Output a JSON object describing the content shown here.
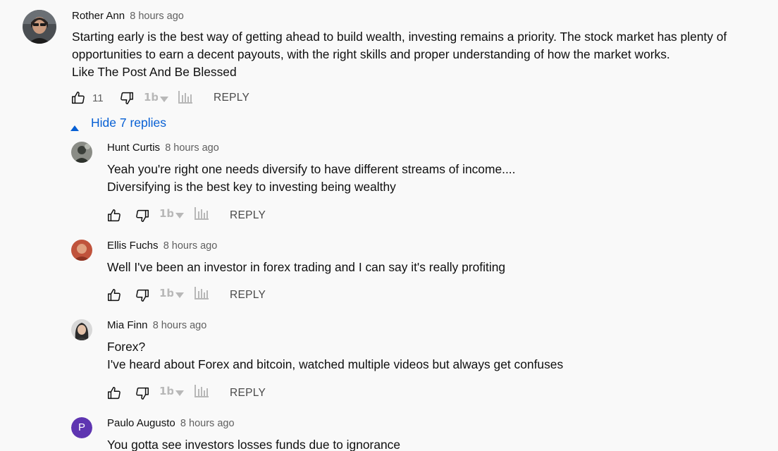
{
  "comment": {
    "author": "Rother Ann",
    "time": "8 hours ago",
    "text_lines": [
      "Starting early is the best way of getting ahead to build wealth, investing remains a priority. The stock market has plenty of",
      "opportunities to earn a decent payouts, with the right skills and proper understanding of how the market works.",
      "Like The Post And Be Blessed"
    ],
    "like_count": "11",
    "reply_label": "REPLY"
  },
  "toggle": {
    "label": "Hide 7 replies"
  },
  "replies": [
    {
      "author": "Hunt Curtis",
      "time": "8 hours ago",
      "text_lines": [
        "Yeah you're right one needs diversify to have different streams of income....",
        "Diversifying is the best key to investing being wealthy"
      ],
      "reply_label": "REPLY"
    },
    {
      "author": "Ellis Fuchs",
      "time": "8 hours ago",
      "text_lines": [
        "Well I've been an investor in forex trading and I can say it's really profiting"
      ],
      "reply_label": "REPLY"
    },
    {
      "author": "Mia Finn",
      "time": "8 hours ago",
      "text_lines": [
        "Forex?",
        "I've heard about Forex and bitcoin, watched multiple videos but always get confuses"
      ],
      "reply_label": "REPLY"
    },
    {
      "author": "Paulo Augusto",
      "avatar_letter": "P",
      "time": "8 hours ago",
      "text_lines": [
        "You gotta see investors losses funds due  to ignorance"
      ]
    }
  ],
  "colors": {
    "background": "#f9f9f9",
    "link_blue": "#065fd4",
    "secondary_text": "#606060",
    "letter_avatar": "#5e35b1"
  },
  "icons": [
    "thumbs-up-icon",
    "thumbs-down-icon",
    "tubebuddy-logo-icon",
    "dropdown-caret-icon",
    "bar-chart-icon",
    "caret-up-icon"
  ]
}
